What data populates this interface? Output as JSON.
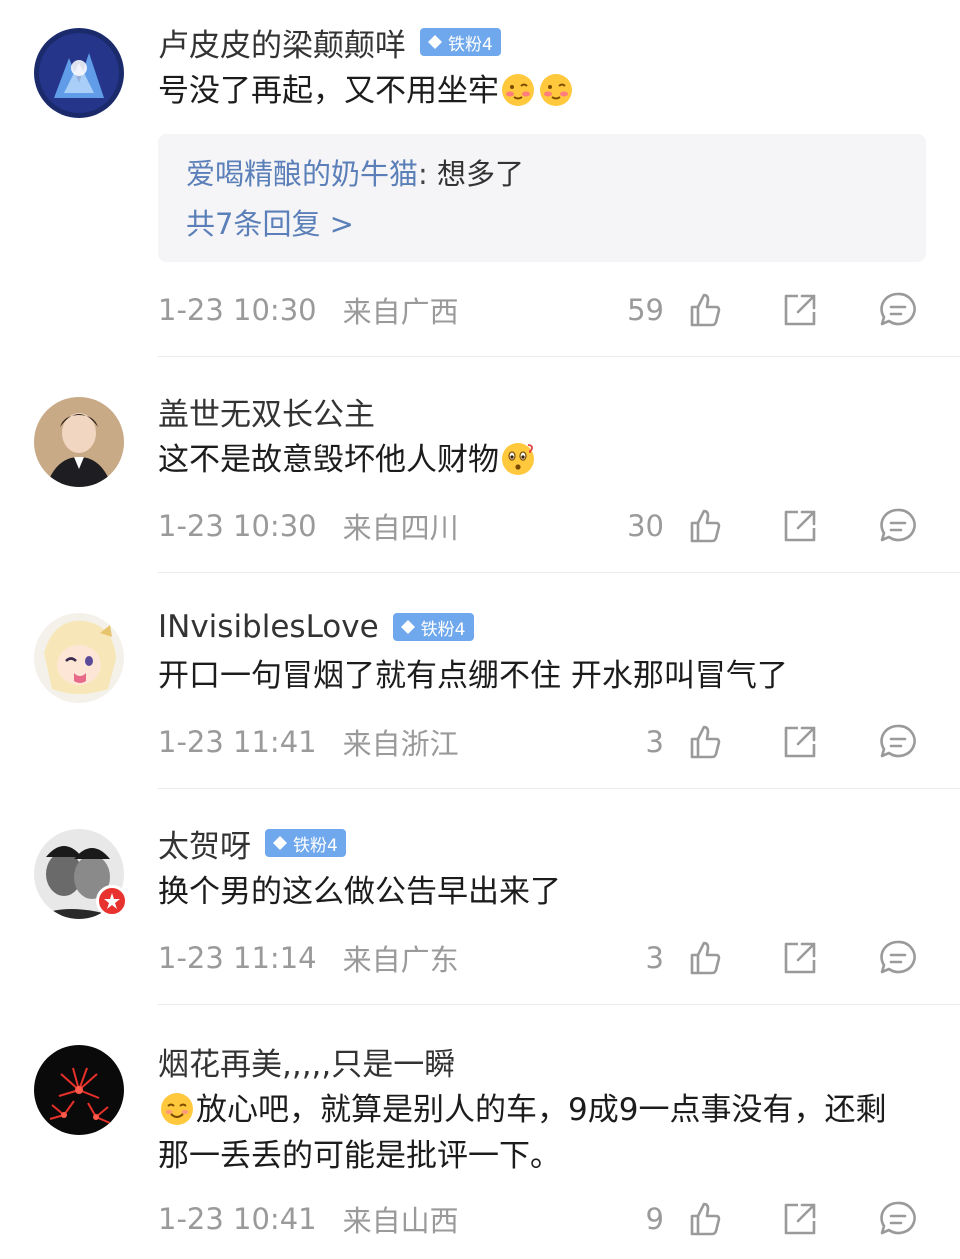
{
  "comments": [
    {
      "user": "卢皮皮的梁颠颠咩",
      "fan_badge": "铁粉4",
      "text": "号没了再起，又不用坐牢",
      "emojis": [
        "blush-face",
        "blush-face"
      ],
      "reply": {
        "user": "爱喝精酿的奶牛猫",
        "colon": ":",
        "text": "想多了",
        "more": "共7条回复 >"
      },
      "time": "1-23 10:30",
      "location": "来自广西",
      "likes": "59"
    },
    {
      "user": "盖世无双长公主",
      "fan_badge": "",
      "text": "这不是故意毁坏他人财物",
      "emojis": [
        "wonder-face"
      ],
      "time": "1-23 10:30",
      "location": "来自四川",
      "likes": "30"
    },
    {
      "user": "INvisiblesLove",
      "fan_badge": "铁粉4",
      "text": "开口一句冒烟了就有点绷不住 开水那叫冒气了",
      "time": "1-23 11:41",
      "location": "来自浙江",
      "likes": "3"
    },
    {
      "user": "太贺呀",
      "fan_badge": "铁粉4",
      "text": "换个男的这么做公告早出来了",
      "time": "1-23 11:14",
      "location": "来自广东",
      "likes": "3"
    },
    {
      "user": "烟花再美,,,,,只是一瞬",
      "fan_badge": "",
      "text_line1": "放心吧，就算是别人的车，9成9一点事没有，还剩",
      "text_line2": "那一丢丢的可能是批评一下。",
      "emojis": [
        "smile-face"
      ],
      "time": "1-23 10:41",
      "location": "来自山西",
      "likes": "9"
    }
  ],
  "colors": {
    "link_blue": "#5b7fb8",
    "fan_badge": "#6fa8ec",
    "meta_gray": "#9a9a9a",
    "reply_bg": "#f5f5f7"
  },
  "icons": [
    "like-icon",
    "share-icon",
    "comment-icon",
    "diamond-icon",
    "verified-star-icon"
  ]
}
